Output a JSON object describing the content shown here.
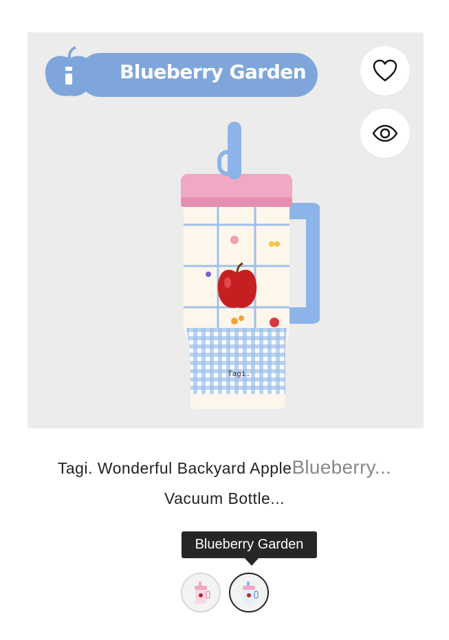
{
  "product": {
    "badge_text": "Blueberry Garden",
    "bottle_brand": "Tagi.",
    "title_main": "Tagi. Wonderful Backyard Apple",
    "title_variant": "Blueberry...",
    "title_line2": "Vacuum Bottle..."
  },
  "actions": {
    "wishlist_icon": "heart-icon",
    "quickview_icon": "eye-icon"
  },
  "swatches": {
    "tooltip": "Blueberry Garden",
    "items": [
      {
        "name": "pink-variant",
        "selected": false
      },
      {
        "name": "blueberry-garden-variant",
        "selected": true
      }
    ]
  },
  "colors": {
    "badge_blue": "#7fa6da",
    "lid_pink": "#f0a8c4",
    "handle_blue": "#8cb4e8",
    "apple_red": "#c61f22",
    "background": "#ececec"
  }
}
